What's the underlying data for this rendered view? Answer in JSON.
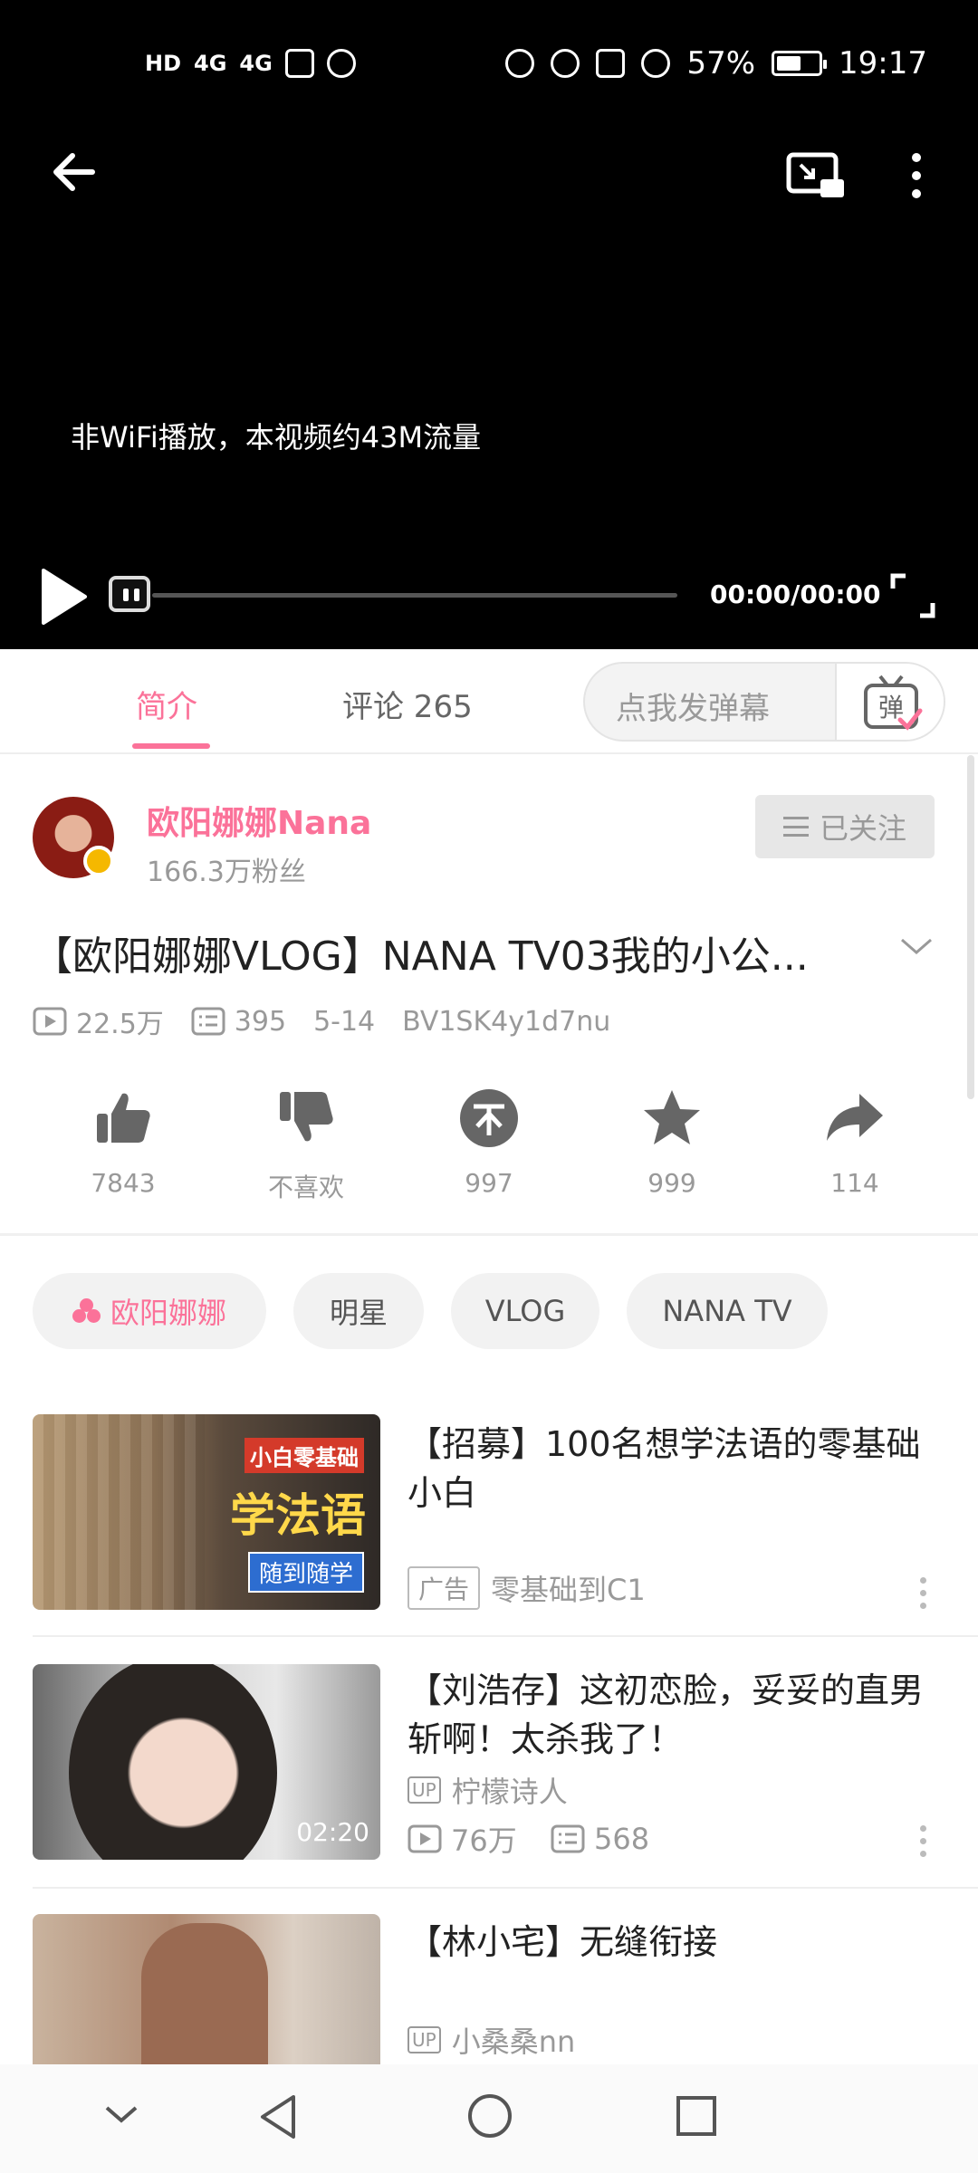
{
  "status_bar": {
    "left_indicators": [
      "HD",
      "4G",
      "4G"
    ],
    "battery": "57%",
    "time": "19:17"
  },
  "player": {
    "notice": "非WiFi播放，本视频约43M流量",
    "time": "00:00/00:00",
    "progress": 0
  },
  "tabs": {
    "intro": "简介",
    "comments": "评论 265",
    "danmaku_placeholder": "点我发弹幕",
    "danmaku_button": "弹"
  },
  "uploader": {
    "name": "欧阳娜娜Nana",
    "fans": "166.3万粉丝",
    "follow_label": "已关注"
  },
  "video": {
    "title": "【欧阳娜娜VLOG】NANA TV03我的小公...",
    "views": "22.5万",
    "danmaku_count": "395",
    "date": "5-14",
    "bvid": "BV1SK4y1d7nu"
  },
  "actions": {
    "like": "7843",
    "dislike": "不喜欢",
    "coin": "997",
    "favorite": "999",
    "share": "114"
  },
  "tags": [
    "欧阳娜娜",
    "明星",
    "VLOG",
    "NANA TV"
  ],
  "related": [
    {
      "title": "【招募】100名想学法语的零基础小白",
      "badge": "广告",
      "author": "零基础到C1",
      "thumb_text": [
        "小白零基础",
        "学法语",
        "随到随学"
      ]
    },
    {
      "title": "【刘浩存】这初恋脸，妥妥的直男斩啊！太杀我了！",
      "up_badge": "UP",
      "author": "柠檬诗人",
      "views": "76万",
      "danmaku": "568",
      "duration": "02:20"
    },
    {
      "title": "【林小宅】无缝衔接",
      "up_badge": "UP",
      "author": "小桑桑nn"
    }
  ],
  "colors": {
    "accent": "#fb7299",
    "text_secondary": "#999999",
    "player_bg": "#000000"
  }
}
